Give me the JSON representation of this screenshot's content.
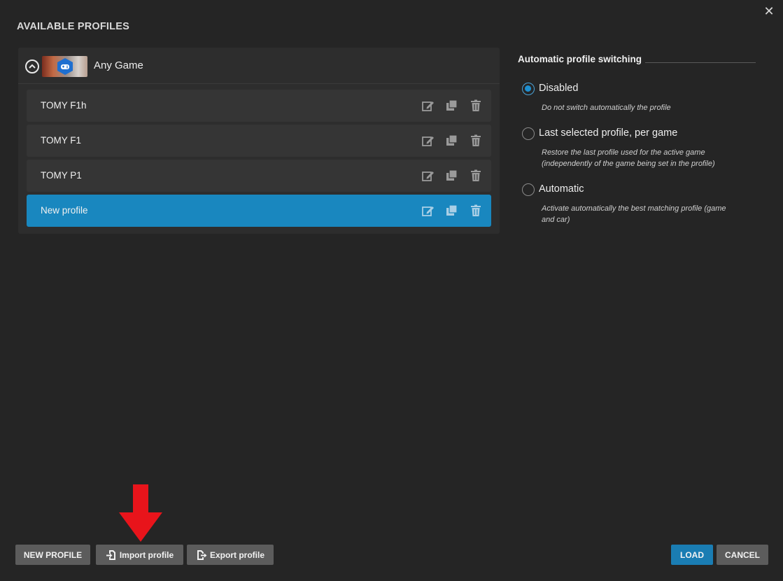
{
  "dialog": {
    "title": "AVAILABLE PROFILES",
    "close_symbol": "✕"
  },
  "group": {
    "label": "Any Game",
    "icon": "gamepad-icon",
    "expanded": true
  },
  "profiles": [
    {
      "name": "TOMY F1h",
      "selected": false
    },
    {
      "name": "TOMY F1",
      "selected": false
    },
    {
      "name": "TOMY P1",
      "selected": false
    },
    {
      "name": "New profile",
      "selected": true
    }
  ],
  "auto_switch": {
    "title": "Automatic profile switching",
    "options": [
      {
        "label": "Disabled",
        "desc_lines": [
          "Do not switch automatically the profile"
        ],
        "checked": true
      },
      {
        "label": "Last selected profile, per game",
        "desc_lines": [
          "Restore the last profile used for the active game",
          "(independently of the game being set in the profile)"
        ],
        "checked": false
      },
      {
        "label": "Automatic",
        "desc_lines": [
          "Activate automatically the best matching profile (game",
          "and car)"
        ],
        "checked": false
      }
    ]
  },
  "buttons": {
    "new_profile": "NEW PROFILE",
    "import_profile": "Import profile",
    "export_profile": "Export profile",
    "load": "LOAD",
    "cancel": "CANCEL"
  },
  "colors": {
    "background": "#252525",
    "selected_row": "#1987bf",
    "accent": "#1a7db3",
    "annotation_arrow": "#e8141b"
  }
}
